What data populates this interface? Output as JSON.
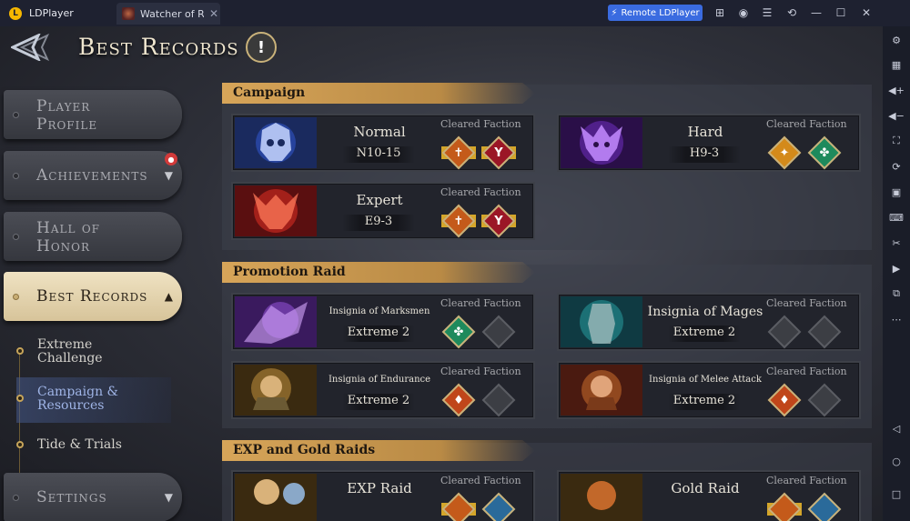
{
  "titlebar": {
    "app_name": "LDPlayer",
    "tab_label": "Watcher of R...",
    "tab_close": "✕",
    "remote_label": "Remote LDPlayer",
    "controls": [
      "⊞",
      "◉",
      "☰",
      "⟲",
      "—",
      "☐",
      "✕"
    ]
  },
  "header": {
    "title": "Best Records",
    "info_icon": "!"
  },
  "nav": {
    "items": [
      {
        "label": "Player Profile"
      },
      {
        "label": "Achievements",
        "arrow": "▼",
        "badge": "●"
      },
      {
        "label": "Hall of Honor"
      },
      {
        "label": "Best Records",
        "arrow": "▲"
      },
      {
        "label": "Settings",
        "arrow": "▼"
      }
    ],
    "sub": [
      {
        "label": "Extreme Challenge"
      },
      {
        "label": "Campaign & Resources"
      },
      {
        "label": "Tide & Trials"
      }
    ]
  },
  "sections": {
    "campaign": "Campaign",
    "promotion": "Promotion Raid",
    "expgold": "EXP and Gold Raids"
  },
  "cleared_faction_label": "Cleared Faction",
  "cards": {
    "normal": {
      "title": "Normal",
      "stage": "N10-15"
    },
    "hard": {
      "title": "Hard",
      "stage": "H9-3"
    },
    "expert": {
      "title": "Expert",
      "stage": "E9-3"
    },
    "marksmen": {
      "title": "Insignia of Marksmen",
      "stage": "Extreme 2"
    },
    "mages": {
      "title": "Insignia of Mages",
      "stage": "Extreme 2"
    },
    "endurance": {
      "title": "Insignia of Endurance",
      "stage": "Extreme 2"
    },
    "melee": {
      "title": "Insignia of Melee Attack",
      "stage": "Extreme 2"
    },
    "exp": {
      "title": "EXP Raid"
    },
    "gold": {
      "title": "Gold Raid"
    }
  },
  "colors": {
    "gold": "#d4a62a",
    "accent": "#3a6be0",
    "section": "#d7a559"
  }
}
